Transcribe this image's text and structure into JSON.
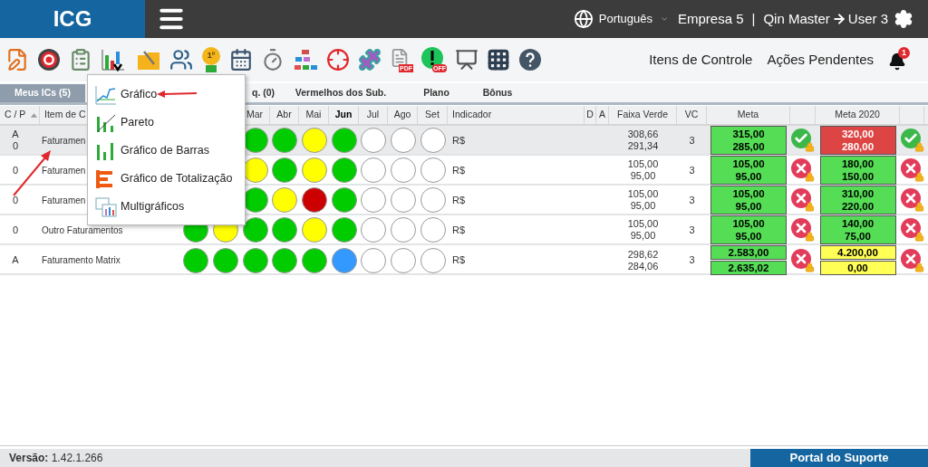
{
  "header": {
    "logo": "ICG",
    "language": "Português",
    "company": "Empresa 5",
    "separator": "|",
    "user_from": "Qin Master",
    "user_to": "User 3"
  },
  "toolbar": [
    {
      "kind": "edit"
    },
    {
      "kind": "target"
    },
    {
      "kind": "clipboard"
    },
    {
      "kind": "chart",
      "expanded": true
    },
    {
      "kind": "folder"
    },
    {
      "kind": "people"
    },
    {
      "kind": "medal",
      "text": "1º"
    },
    {
      "kind": "calendar"
    },
    {
      "kind": "stopwatch"
    },
    {
      "kind": "org"
    },
    {
      "kind": "crosshair"
    },
    {
      "kind": "puzzle"
    },
    {
      "kind": "pdf",
      "text": "PDF"
    },
    {
      "kind": "alert",
      "text": "OFF"
    },
    {
      "kind": "presentation"
    },
    {
      "kind": "grid"
    },
    {
      "kind": "help"
    }
  ],
  "nav": {
    "links": [
      "Itens de Controle",
      "Ações Pendentes"
    ],
    "notifications": "1"
  },
  "chart_menu": [
    {
      "label": "Gráfico"
    },
    {
      "label": "Pareto"
    },
    {
      "label": "Gráfico de Barras"
    },
    {
      "label": "Gráfico de Totalização"
    },
    {
      "label": "Multigráficos"
    }
  ],
  "tabs": [
    {
      "label": "Meus ICs (5)",
      "selected": true
    },
    {
      "label": "q. (0)",
      "selected": false
    },
    {
      "label": "Vermelhos dos Sub.",
      "selected": false
    },
    {
      "label": "Plano",
      "selected": false
    },
    {
      "label": "Bônus",
      "selected": false
    }
  ],
  "table": {
    "columns": [
      {
        "label": "C / P",
        "current": false
      },
      {
        "label": "Item de C",
        "current": false
      },
      {
        "label": "Mar",
        "current": false
      },
      {
        "label": "Abr",
        "current": false
      },
      {
        "label": "Mai",
        "current": false
      },
      {
        "label": "Jun",
        "current": true
      },
      {
        "label": "Jul",
        "current": false
      },
      {
        "label": "Ago",
        "current": false
      },
      {
        "label": "Set",
        "current": false
      },
      {
        "label": "Indicador",
        "current": false
      },
      {
        "label": "D",
        "current": false
      },
      {
        "label": "A",
        "current": false
      },
      {
        "label": "Faixa Verde",
        "current": false
      },
      {
        "label": "VC",
        "current": false
      },
      {
        "label": "Meta",
        "current": false
      },
      {
        "label": "Meta 2020",
        "current": false
      }
    ],
    "rows": [
      {
        "selected": true,
        "cp": [
          "A",
          "0"
        ],
        "item": "Faturamen",
        "months": [
          {
            "color": "#00cc00"
          },
          {
            "color": "#00cc00"
          },
          {
            "color": "#ffff00"
          },
          {
            "color": "#00cc00"
          },
          {
            "color": "#ffffff"
          },
          {
            "color": "#ffffff"
          },
          {
            "color": "#ffffff"
          }
        ],
        "indicator": "R$",
        "range": [
          "308,66",
          "291,34"
        ],
        "vc": "3",
        "meta": {
          "values": [
            "315,00",
            "285,00"
          ],
          "color": "#55dd55",
          "split": false,
          "passed": true
        },
        "meta2020": {
          "values": [
            "320,00",
            "280,00"
          ],
          "color": "#dd4444",
          "split": false,
          "passed": true
        }
      },
      {
        "selected": false,
        "cp": [
          "0"
        ],
        "item": "Faturamen",
        "months": [
          {
            "color": "#ffff00"
          },
          {
            "color": "#00cc00"
          },
          {
            "color": "#ffff00"
          },
          {
            "color": "#00cc00"
          },
          {
            "color": "#ffffff"
          },
          {
            "color": "#ffffff"
          },
          {
            "color": "#ffffff"
          }
        ],
        "indicator": "R$",
        "range": [
          "105,00",
          "95,00"
        ],
        "vc": "3",
        "meta": {
          "values": [
            "105,00",
            "95,00"
          ],
          "color": "#55dd55",
          "split": false,
          "passed": false
        },
        "meta2020": {
          "values": [
            "180,00",
            "150,00"
          ],
          "color": "#55dd55",
          "split": false,
          "passed": false
        }
      },
      {
        "selected": false,
        "cp": [
          "0"
        ],
        "item": "Faturamen",
        "months": [
          {
            "color": "#00cc00"
          },
          {
            "color": "#ffff00"
          },
          {
            "color": "#cc0000"
          },
          {
            "color": "#00cc00"
          },
          {
            "color": "#ffffff"
          },
          {
            "color": "#ffffff"
          },
          {
            "color": "#ffffff"
          }
        ],
        "indicator": "R$",
        "range": [
          "105,00",
          "95,00"
        ],
        "vc": "3",
        "meta": {
          "values": [
            "105,00",
            "95,00"
          ],
          "color": "#55dd55",
          "split": false,
          "passed": false
        },
        "meta2020": {
          "values": [
            "310,00",
            "220,00"
          ],
          "color": "#55dd55",
          "split": false,
          "passed": false
        }
      },
      {
        "selected": false,
        "cp": [
          "0"
        ],
        "item": "Outro Faturamentos",
        "months": [
          {
            "color": "#00cc00"
          },
          {
            "color": "#ffff00"
          },
          {
            "color": "#00cc00"
          },
          {
            "color": "#00cc00"
          },
          {
            "color": "#ffff00"
          },
          {
            "color": "#00cc00"
          },
          {
            "color": "#ffffff"
          },
          {
            "color": "#ffffff"
          },
          {
            "color": "#ffffff"
          }
        ],
        "indicator": "R$",
        "range": [
          "105,00",
          "95,00"
        ],
        "vc": "3",
        "meta": {
          "values": [
            "105,00",
            "95,00"
          ],
          "color": "#55dd55",
          "split": false,
          "passed": false
        },
        "meta2020": {
          "values": [
            "140,00",
            "75,00"
          ],
          "color": "#55dd55",
          "split": false,
          "passed": false
        }
      },
      {
        "selected": false,
        "cp": [
          "A"
        ],
        "item": "Faturamento Matrix",
        "months": [
          {
            "color": "#00cc00"
          },
          {
            "color": "#00cc00"
          },
          {
            "color": "#00cc00"
          },
          {
            "color": "#00cc00"
          },
          {
            "color": "#00cc00"
          },
          {
            "color": "#3399ff"
          },
          {
            "color": "#ffffff"
          },
          {
            "color": "#ffffff"
          },
          {
            "color": "#ffffff"
          }
        ],
        "indicator": "R$",
        "range": [
          "298,62",
          "284,06"
        ],
        "vc": "3",
        "meta": {
          "values": [
            "2.583,00",
            "2.635,02"
          ],
          "color": "#55dd55",
          "split": true,
          "passed": false
        },
        "meta2020": {
          "values": [
            "4.200,00",
            "0,00"
          ],
          "color": "#ffff55",
          "split": true,
          "passed": false
        }
      }
    ]
  },
  "footer": {
    "version": "**Versão:** 1.42.1.266",
    "support": "Portal do Suporte"
  }
}
